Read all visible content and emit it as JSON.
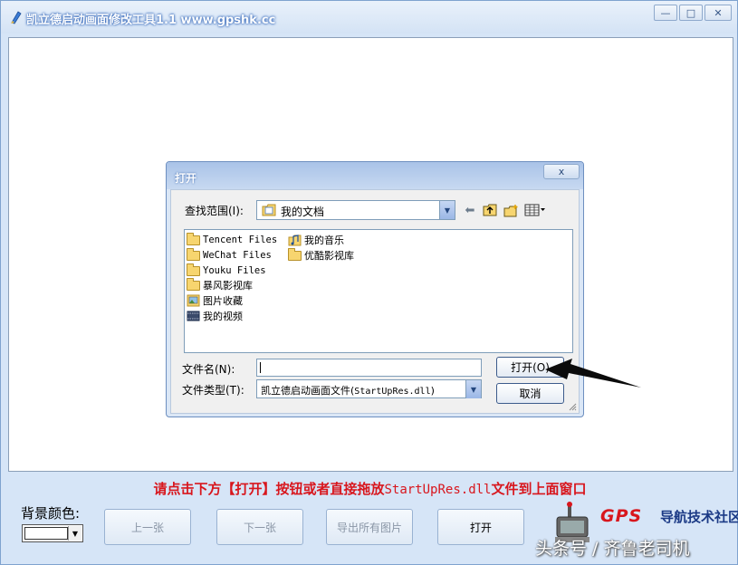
{
  "window": {
    "title": "凯立德启动画面修改工具1.1 www.gpshk.cc",
    "minimize": "—",
    "maximize": "□",
    "close": "✕"
  },
  "hint": {
    "prefix": "请点击下方【打开】按钮或者直接拖放",
    "file": "StartUpRes.dll",
    "suffix": "文件到上面窗口"
  },
  "background_color": {
    "label": "背景颜色:",
    "value": "#ffffff"
  },
  "buttons": {
    "prev": "上一张",
    "next": "下一张",
    "export": "导出所有图片",
    "open": "打开"
  },
  "logo": {
    "gps": "GPS",
    "text": "导航技术社区"
  },
  "watermark": "头条号 / 齐鲁老司机",
  "dialog": {
    "title": "打开",
    "close": "x",
    "look_in_label": "查找范围(I):",
    "look_in_value": "我的文档",
    "files": [
      {
        "name": "Tencent Files",
        "icon": "folder-icon"
      },
      {
        "name": "WeChat Files",
        "icon": "folder-icon"
      },
      {
        "name": "Youku Files",
        "icon": "folder-icon"
      },
      {
        "name": "暴风影视库",
        "icon": "folder-icon"
      },
      {
        "name": "图片收藏",
        "icon": "pictures-folder-icon"
      },
      {
        "name": "我的视频",
        "icon": "videos-folder-icon"
      },
      {
        "name": "我的音乐",
        "icon": "music-folder-icon"
      },
      {
        "name": "优酷影视库",
        "icon": "folder-icon"
      }
    ],
    "file_name_label": "文件名(N):",
    "file_name_value": "",
    "file_type_label": "文件类型(T):",
    "file_type_prefix": "凯立德启动画面文件(",
    "file_type_ext": "StartUpRes.dll",
    "file_type_suffix": ")",
    "open_button": "打开(O)",
    "cancel_button": "取消"
  }
}
